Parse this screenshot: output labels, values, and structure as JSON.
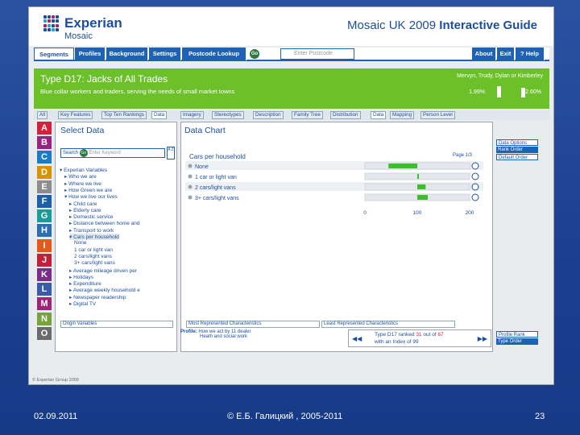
{
  "header": {
    "brand": "Experian",
    "sub": "Mosaic",
    "title_plain": "Mosaic UK 2009 ",
    "title_bold": "Interactive Guide"
  },
  "nav": {
    "items": [
      "Segments",
      "Profiles",
      "Background",
      "Settings",
      "Postcode Lookup"
    ],
    "go": "Go",
    "postcode_placeholder": "Enter Postcode",
    "right": [
      "About",
      "Exit",
      "? Help"
    ]
  },
  "banner": {
    "title": "Type D17: Jacks of All Trades",
    "description": "Blue collar workers and traders, serving the needs of small market towns",
    "names": "Mervyn, Trudy, Dylan or Kimberley",
    "stat1": "1.99%",
    "stat2": "2.60%"
  },
  "tabs": {
    "left": [
      "Key Features",
      "Top Ten Rankings",
      "Data"
    ],
    "right": [
      "Imagery",
      "Stereotypes",
      "Description",
      "Family Tree",
      "Distribution",
      "Data",
      "Mapping",
      "Person Level"
    ]
  },
  "letters": [
    "A",
    "B",
    "C",
    "D",
    "E",
    "F",
    "G",
    "H",
    "I",
    "J",
    "K",
    "L",
    "M",
    "N",
    "O"
  ],
  "letter_colors": [
    "#d4203a",
    "#93277f",
    "#1a7cc3",
    "#d89400",
    "#8c8c8c",
    "#1d5fa8",
    "#1b9c9a",
    "#2b6fb1",
    "#e05a1a",
    "#c41e3a",
    "#7a2c86",
    "#3b5aa8",
    "#9c2479",
    "#76a33b",
    "#6b6b6b"
  ],
  "select_data": {
    "title": "Select Data",
    "search_label": "Search",
    "go": "Go",
    "keyword_placeholder": "Enter Keyword",
    "az": "A Z",
    "tree": [
      "Experian Variables",
      "Who we are",
      "Where we live",
      "How Green we are",
      "How we live our lives",
      "Child care",
      "Elderly care",
      "Domestic service",
      "Distance between home and",
      "Transport to work",
      "Cars per household",
      "None",
      "1 car or light van",
      "2 cars/light vans",
      "3+ cars/light vans",
      "Average mileage driven per",
      "Holidays",
      "Expenditure",
      "Average weekly household e",
      "Newspaper readership",
      "Digital TV"
    ],
    "origin": "Origin Variables"
  },
  "data_chart": {
    "title": "Data Chart",
    "subtitle": "Cars per household",
    "page": "Page 1/3",
    "most": "Most Represented Characteristics",
    "least": "Least Represented Characteristics"
  },
  "chart_data": {
    "type": "bar",
    "title": "Cars per household",
    "categories": [
      "None",
      "1 car or light van",
      "2 cars/light vans",
      "3+ cars/light vans"
    ],
    "values": [
      45,
      100,
      116,
      120
    ],
    "baseline": 100,
    "xlim": [
      0,
      200
    ],
    "xticks": [
      "0",
      "100",
      "200"
    ]
  },
  "side_options": [
    "Data Options",
    "Rank Order",
    "Default Order"
  ],
  "profile": {
    "label": "Profile:",
    "text": "How we act by 11 dealer",
    "text2": "Heath and social work",
    "rank_text1": "Type D17 ranked ",
    "rank_num": "31",
    "rank_of": " out of ",
    "rank_total": "67",
    "rank_text2": "with an Index of 99",
    "buttons": [
      "Profile Rank",
      "Type Order"
    ]
  },
  "copyright": "© Experian Group 2009",
  "slide": {
    "date": "02.09.2011",
    "author": "© Е.Б. Галицкий , 2005-2011",
    "page": "23"
  }
}
